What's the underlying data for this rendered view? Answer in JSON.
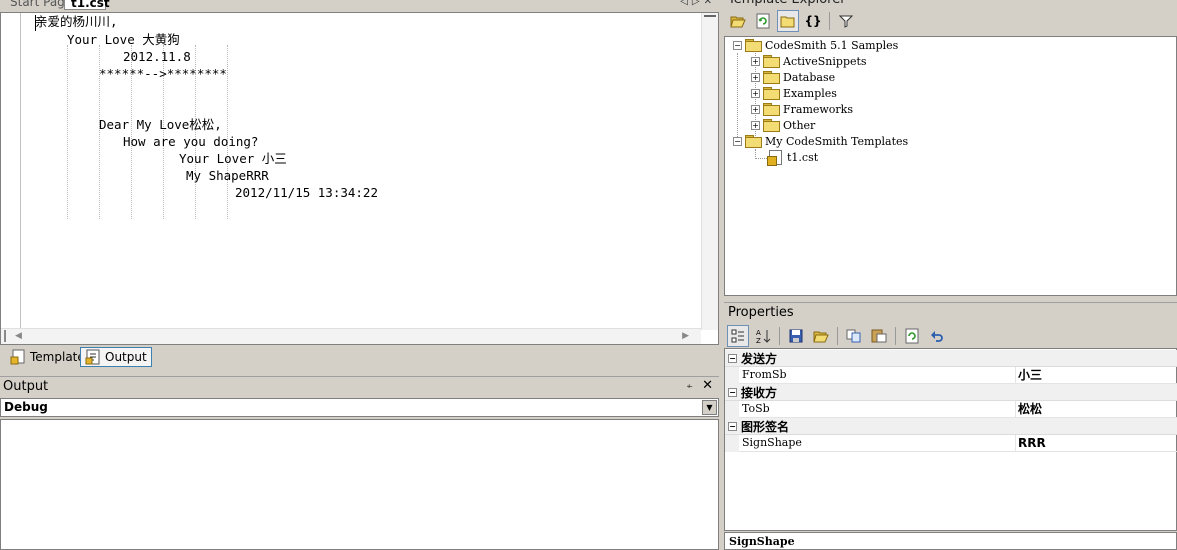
{
  "document_tabs": {
    "start_page": "Start Page",
    "active": "t1.cst"
  },
  "editor": {
    "lines": [
      "亲爱的杨川川,",
      "Your Love 大黄狗",
      "2012.11.8",
      "******-->********",
      "Dear My Love松松,",
      "How are you doing?",
      "Your Lover 小三",
      "My ShapeRRR",
      "2012/11/15 13:34:22"
    ]
  },
  "view_tabs": {
    "template": "Template",
    "output": "Output"
  },
  "output_panel": {
    "title": "Output",
    "pin": "⍅",
    "close": "✕",
    "source": "Debug"
  },
  "template_explorer": {
    "title": "Template Explorer",
    "tree": [
      {
        "label": "CodeSmith 5.1 Samples",
        "expanded": true
      },
      {
        "label": "ActiveSnippets"
      },
      {
        "label": "Database"
      },
      {
        "label": "Examples"
      },
      {
        "label": "Frameworks"
      },
      {
        "label": "Other"
      },
      {
        "label": "My CodeSmith Templates",
        "expanded": true
      },
      {
        "label": "t1.cst"
      }
    ]
  },
  "properties": {
    "title": "Properties",
    "categories": [
      {
        "name": "发送方",
        "prop": "FromSb",
        "value": "小三"
      },
      {
        "name": "接收方",
        "prop": "ToSb",
        "value": "松松"
      },
      {
        "name": "图形签名",
        "prop": "SignShape",
        "value": "RRR"
      }
    ],
    "description": "SignShape"
  },
  "colors": {
    "chrome": "#d4d0c8",
    "folder": "#f3dc74",
    "selection_border": "#3c7fb1"
  }
}
